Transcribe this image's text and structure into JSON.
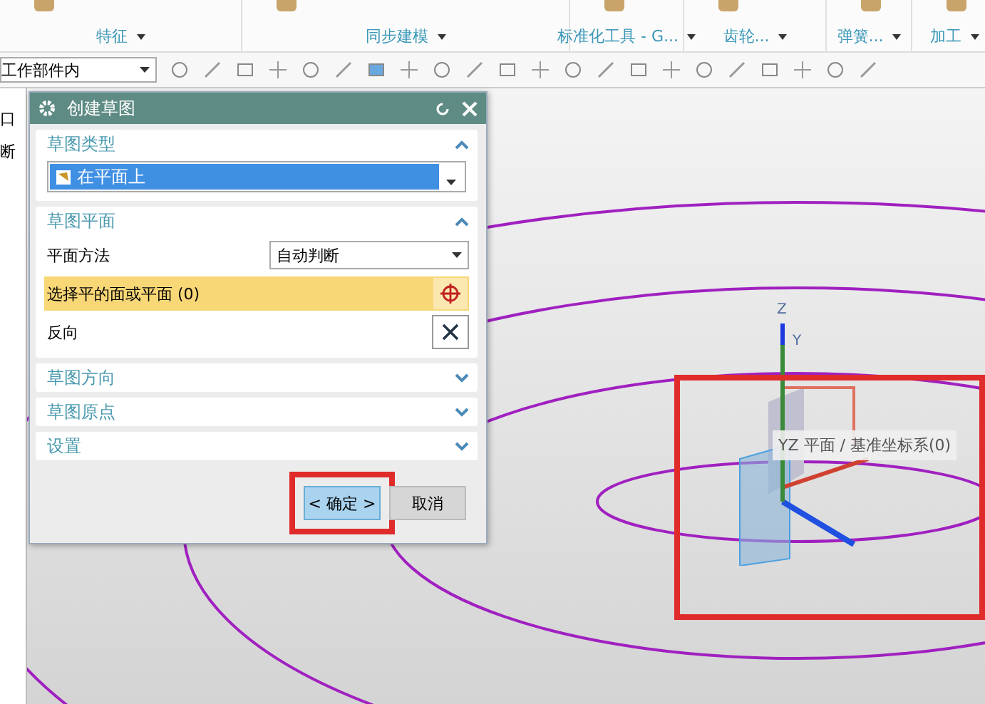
{
  "ribbon": {
    "groups": [
      {
        "label": "特征"
      },
      {
        "label": "同步建模"
      },
      {
        "label": "标准化工具 - G..."
      },
      {
        "label": "齿轮..."
      },
      {
        "label": "弹簧..."
      },
      {
        "label": "加工"
      }
    ]
  },
  "toolbar": {
    "scope": "工作部件内"
  },
  "left_strip": {
    "items": [
      "口",
      "断"
    ]
  },
  "dialog": {
    "title": "创建草图",
    "sections": [
      {
        "title": "草图类型",
        "expanded": true,
        "rows": [
          {
            "kind": "type",
            "value": "在平面上"
          }
        ]
      },
      {
        "title": "草图平面",
        "expanded": true,
        "rows": [
          {
            "kind": "dropdown",
            "label": "平面方法",
            "value": "自动判断"
          },
          {
            "kind": "selector",
            "label": "选择平的面或平面 (0)",
            "selected": true
          },
          {
            "kind": "action",
            "label": "反向"
          }
        ]
      },
      {
        "title": "草图方向",
        "expanded": false
      },
      {
        "title": "草图原点",
        "expanded": false
      },
      {
        "title": "设置",
        "expanded": false
      }
    ],
    "buttons": [
      {
        "label": "< 确定 >",
        "kind": "primary",
        "highlighted": true
      },
      {
        "label": "取消",
        "kind": "secondary",
        "highlighted": false
      }
    ]
  },
  "viewport": {
    "axis_labels": [
      "Z",
      "Y"
    ],
    "tooltip": "YZ 平面 / 基准坐标系(0)",
    "frame_highlighted": true
  }
}
